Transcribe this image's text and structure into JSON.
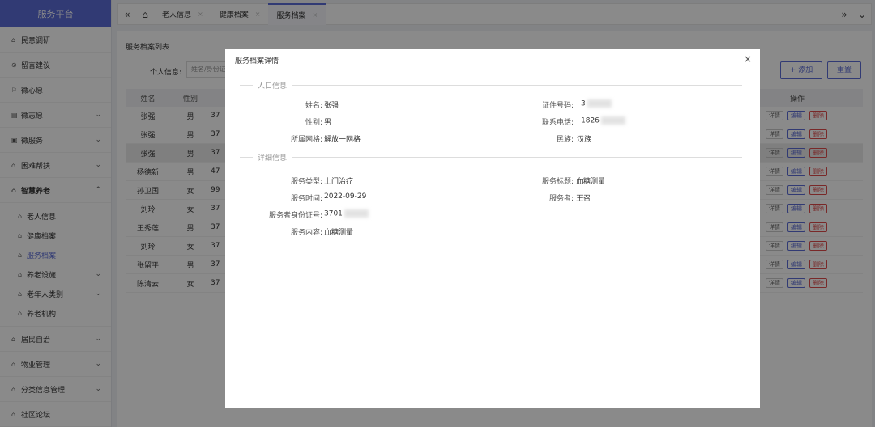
{
  "sidebar": {
    "brand": "服务平台",
    "items": [
      {
        "label": "民意调研",
        "icon": "home-icon",
        "chev": ""
      },
      {
        "label": "留言建议",
        "icon": "message-icon",
        "chev": ""
      },
      {
        "label": "微心愿",
        "icon": "flag-icon",
        "chev": ""
      },
      {
        "label": "微志愿",
        "icon": "list-icon",
        "chev": "⌄"
      },
      {
        "label": "微服务",
        "icon": "grid-icon",
        "chev": "⌄"
      },
      {
        "label": "困难帮扶",
        "icon": "home-icon",
        "chev": "⌄"
      },
      {
        "label": "智慧养老",
        "icon": "home-icon",
        "chev": "⌃"
      }
    ],
    "sub_items": [
      {
        "label": "老人信息",
        "chev": ""
      },
      {
        "label": "健康档案",
        "chev": ""
      },
      {
        "label": "服务档案",
        "chev": ""
      },
      {
        "label": "养老设施",
        "chev": "⌄"
      },
      {
        "label": "老年人类别",
        "chev": "⌄"
      },
      {
        "label": "养老机构",
        "chev": ""
      }
    ],
    "items_after": [
      {
        "label": "居民自治",
        "chev": "⌄"
      },
      {
        "label": "物业管理",
        "chev": "⌄"
      },
      {
        "label": "分类信息管理",
        "chev": "⌄"
      },
      {
        "label": "社区论坛",
        "chev": ""
      }
    ]
  },
  "tabs": [
    {
      "label": "老人信息"
    },
    {
      "label": "健康档案"
    },
    {
      "label": "服务档案"
    }
  ],
  "main": {
    "title": "服务档案列表",
    "filter_label": "个人信息:",
    "filter_placeholder": "姓名/身份证",
    "add_button": "+ 添加",
    "reset_button": "重置",
    "headers": {
      "name": "姓名",
      "gender": "性别",
      "op": "操作"
    },
    "rows": [
      {
        "name": "张强",
        "gender": "男",
        "age": "37"
      },
      {
        "name": "张强",
        "gender": "男",
        "age": "37"
      },
      {
        "name": "张强",
        "gender": "男",
        "age": "37"
      },
      {
        "name": "杨德新",
        "gender": "男",
        "age": "47"
      },
      {
        "name": "孙卫国",
        "gender": "女",
        "age": "99"
      },
      {
        "name": "刘玲",
        "gender": "女",
        "age": "37"
      },
      {
        "name": "王秀莲",
        "gender": "男",
        "age": "37"
      },
      {
        "name": "刘玲",
        "gender": "女",
        "age": "37"
      },
      {
        "name": "张留平",
        "gender": "男",
        "age": "37"
      },
      {
        "name": "陈清云",
        "gender": "女",
        "age": "37"
      }
    ],
    "ops": {
      "detail": "详情",
      "edit": "编辑",
      "del": "删除"
    }
  },
  "modal": {
    "title": "服务档案详情",
    "section_population": "人口信息",
    "section_detail": "详细信息",
    "name_label": "姓名:",
    "name_value": "张强",
    "id_label": "证件号码:",
    "id_value": "3",
    "gender_label": "性别:",
    "gender_value": "男",
    "phone_label": "联系电话:",
    "phone_value": "1826",
    "grid_label": "所属网格:",
    "grid_value": "解放一网格",
    "ethnic_label": "民族:",
    "ethnic_value": "汉族",
    "service_type_label": "服务类型:",
    "service_type_value": "上门治疗",
    "service_title_label": "服务标题:",
    "service_title_value": "血糖测量",
    "service_time_label": "服务时间:",
    "service_time_value": "2022-09-29",
    "provider_label": "服务者:",
    "provider_value": "王召",
    "provider_id_label": "服务者身份证号:",
    "provider_id_value": "3701",
    "content_label": "服务内容:",
    "content_value": "血糖测量"
  }
}
